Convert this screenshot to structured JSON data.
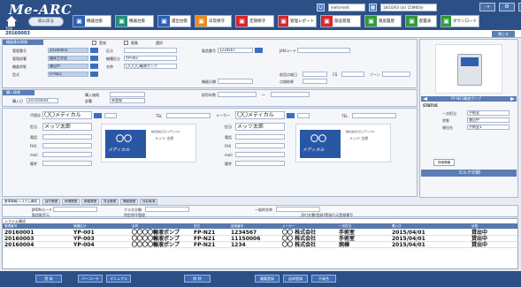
{
  "header": {
    "logo": "Me-ARC",
    "top_label": "TOP",
    "back_button": "前に戻る",
    "user_field": "mefs/mefs",
    "date_field": "18/10/03 (水) 15時00分",
    "nav": [
      {
        "label": "機器台帳",
        "color": "#2d5fb5",
        "icon": "book-icon"
      },
      {
        "label": "機器台帳",
        "color": "#1e8f7a",
        "icon": "gear-icon"
      },
      {
        "label": "貸出台帳",
        "color": "#2d5fb5",
        "icon": "loan-icon"
      },
      {
        "label": "日常保守",
        "color": "#e98a1c",
        "icon": "sun-icon"
      },
      {
        "label": "定期保守",
        "color": "#d8252b",
        "icon": "wrench-icon"
      },
      {
        "label": "管理レポート",
        "color": "#d8252b",
        "icon": "report-icon"
      },
      {
        "label": "部品管理",
        "color": "#d8252b",
        "icon": "parts-icon"
      },
      {
        "label": "資産履歴",
        "color": "#2e9b3a",
        "icon": "history-icon"
      },
      {
        "label": "配置表",
        "color": "#2e9b3a",
        "icon": "layout-icon"
      },
      {
        "label": "ダウンロード",
        "color": "#2e9b3a",
        "icon": "download-icon"
      }
    ]
  },
  "record_id": "20160003",
  "basic": {
    "title": "機器基本情報",
    "mgmt_no_label": "管理番号",
    "mgmt_no": "20160003",
    "status_label": "区分",
    "status": "",
    "model_no_label": "製造番号",
    "model_no": "1234567",
    "jan_label": "JANコード",
    "mgmt_dept_label": "管理部署",
    "mgmt_dept": "臨床工学室",
    "model_label": "機種区分",
    "model": "YP-003",
    "place_label": "機器状態",
    "place": "貸出中",
    "name_label": "名称",
    "name": "〇〇〇〇輸液ポンプ",
    "type_label": "型式",
    "type": "FP-N21",
    "cat_label": "機器分類",
    "prev_label": "前回点検日",
    "check_label": "点検結果",
    "cls_label": "CS",
    "zone_label": "ゾーン"
  },
  "buy": {
    "title": "購入情報",
    "date_label": "購入日",
    "date": "2015/04/01",
    "price_label": "購入価格",
    "dept_label": "部署",
    "dept": "未登録",
    "period_label": "耐用年数"
  },
  "maker": {
    "label": "代理店",
    "name": "〇〇メディカル",
    "person_label": "担当",
    "person": "メッツ太郎",
    "tel_label": "電話",
    "fax_label": "FAX",
    "mail_label": "mail",
    "note_label": "備考",
    "maker_label": "メーカー",
    "maker_name": "〇〇メディカル",
    "card_name": "メッツ 太郎",
    "card_oo": "〇〇",
    "card_med": "メディカル",
    "card_company": "株式会社〇〇メディカル"
  },
  "right": {
    "img_label": "FP-N21輸液ポンプ",
    "status_title": "STATUS",
    "rows": [
      {
        "k": "一次担当",
        "v": "手術室"
      },
      {
        "k": "状態",
        "v": "貸出中"
      },
      {
        "k": "貸出先",
        "v": "手術室1"
      }
    ],
    "detail_btn": "詳細情報",
    "card_btn": "カルテ印刷"
  },
  "tabs": [
    "基準情報/システム構成",
    "保守履歴",
    "修理履歴",
    "移動履歴",
    "貸出履歴",
    "異動履歴",
    "特記事項"
  ],
  "tabfields": {
    "jmdn": "JMDNコード",
    "group": "クラス分類",
    "cert": "承認番号",
    "maker_code": "製造販売元",
    "spec": "管理区分",
    "other": "一般的名称",
    "std": "特定保守管理",
    "note": "添付文書(登録)等発行元登録番号"
  },
  "table": {
    "title": "システム構成",
    "columns": [
      "管理番号",
      "機種区分",
      "名称",
      "型式",
      "製造番号",
      "メーカー",
      "一次担当",
      "購入日",
      "状態"
    ],
    "rows": [
      [
        "20160001",
        "YP-001",
        "〇〇〇〇輸液ポンプ",
        "FP-N21",
        "1234567",
        "〇〇 株式会社",
        "手術室",
        "2015/04/01",
        "貸出中"
      ],
      [
        "20160003",
        "YP-003",
        "〇〇〇〇輸液ポンプ",
        "FP-N21",
        "11150006",
        "〇〇 株式会社",
        "手術室",
        "2015/04/01",
        "貸出中"
      ],
      [
        "20160004",
        "YP-004",
        "〇〇〇〇輸液ポンプ",
        "FP-N21",
        "1234",
        "〇〇 株式会社",
        "病棟",
        "2015/04/01",
        "貸出中"
      ]
    ]
  },
  "footer": {
    "buttons": [
      "登 録",
      "バーコード",
      "マニュアル",
      "削 除",
      "複製登録",
      "返却登録",
      "不具合"
    ]
  }
}
